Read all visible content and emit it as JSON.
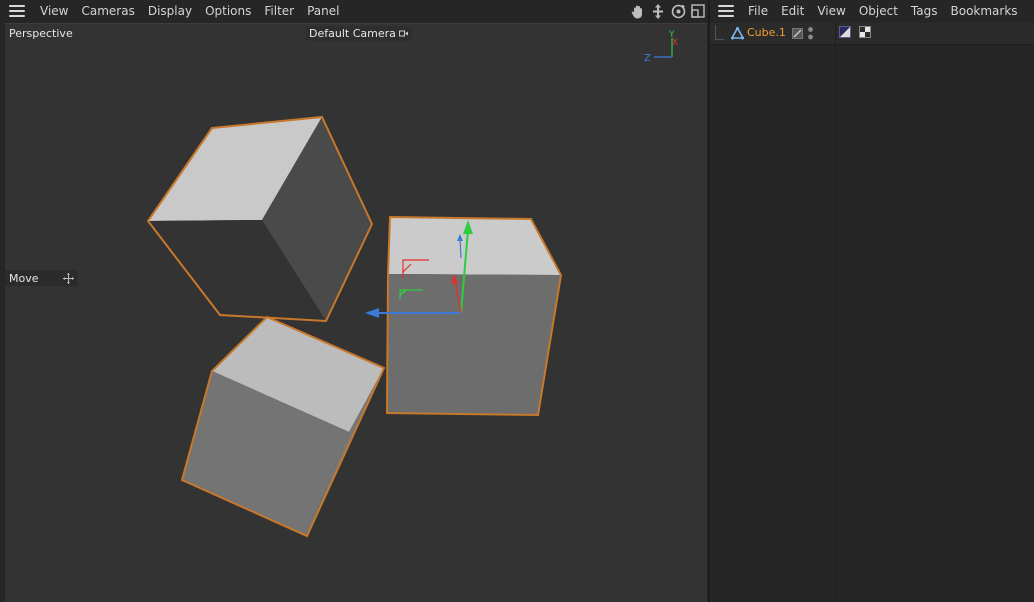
{
  "viewport": {
    "menu": [
      "View",
      "Cameras",
      "Display",
      "Options",
      "Filter",
      "Panel"
    ],
    "view_label": "Perspective",
    "camera_label": "Default Camera",
    "hud_tool": "Move",
    "axis_labels": {
      "y": "Y",
      "x": "X",
      "z": "Z"
    },
    "nav_tools": [
      "hand-pan-icon",
      "move-arrows-icon",
      "rotate-orbit-icon",
      "maximize-view-icon"
    ]
  },
  "object_manager": {
    "menu": [
      "File",
      "Edit",
      "View",
      "Object",
      "Tags",
      "Bookmarks"
    ],
    "objects": [
      {
        "name": "Cube.1",
        "selected": true
      }
    ],
    "colors": {
      "selected_name": "#f0a030",
      "selection_outline": "#c8782a"
    }
  }
}
